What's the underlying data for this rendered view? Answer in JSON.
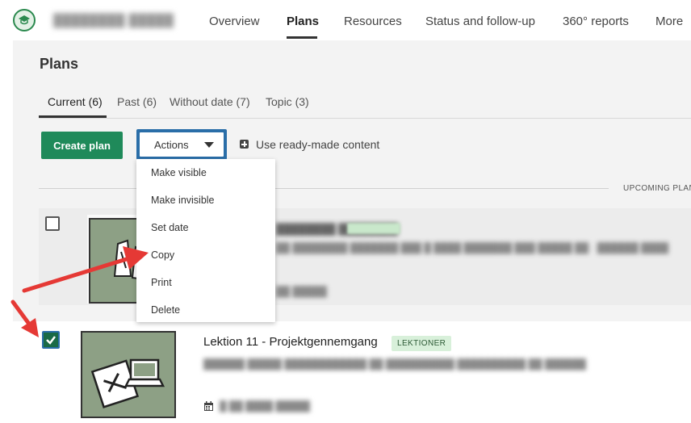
{
  "nav": {
    "items": [
      {
        "label": "Overview"
      },
      {
        "label": "Plans"
      },
      {
        "label": "Resources"
      },
      {
        "label": "Status and follow-up"
      },
      {
        "label": "360° reports"
      },
      {
        "label": "More"
      }
    ]
  },
  "page": {
    "title": "Plans"
  },
  "tabs": [
    {
      "label": "Current (6)"
    },
    {
      "label": "Past (6)"
    },
    {
      "label": "Without date (7)"
    },
    {
      "label": "Topic (3)"
    }
  ],
  "toolbar": {
    "create_label": "Create plan",
    "actions_label": "Actions",
    "ready_made_label": "Use ready-made content"
  },
  "upcoming_label": "UPCOMING PLANS",
  "actions_menu": [
    {
      "label": "Make visible"
    },
    {
      "label": "Make invisible"
    },
    {
      "label": "Set date"
    },
    {
      "label": "Copy"
    },
    {
      "label": "Print"
    },
    {
      "label": "Delete"
    }
  ],
  "plans": [
    {
      "title": "",
      "badge": "",
      "selected": false
    },
    {
      "title": "Lektion 11 - Projektgennemgang",
      "badge": "LEKTIONER",
      "selected": true
    }
  ],
  "colors": {
    "primary_green": "#1f8a5a",
    "focus_blue": "#2a6ea8",
    "annotation_red": "#e53935",
    "badge_green": "#d8f0da"
  },
  "icons": [
    "graduation-cap-icon",
    "chevron-down-icon",
    "plus-square-icon",
    "checkmark-icon",
    "calendar-icon"
  ]
}
